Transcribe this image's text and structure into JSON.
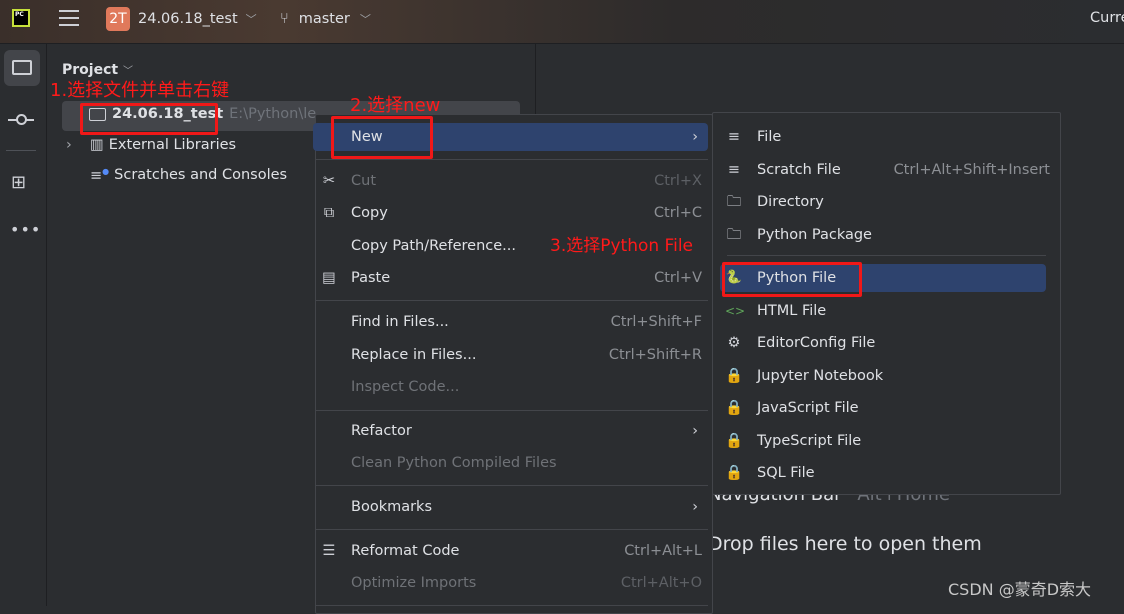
{
  "titlebar": {
    "project_badge": "2T",
    "project_name": "24.06.18_test",
    "branch": "master",
    "right_text": "Curre",
    "badge_color": "#e0795b"
  },
  "project_panel": {
    "title": "Project",
    "tree": [
      {
        "label": "24.06.18_test",
        "path": "E:\\Python\\le",
        "icon": "folder-icon"
      },
      {
        "label": "External Libraries",
        "icon": "library-icon"
      },
      {
        "label": "Scratches and Consoles",
        "icon": "scratch-icon"
      }
    ]
  },
  "context_menu": {
    "items": [
      {
        "label": "New",
        "submenu": true,
        "highlighted": true
      },
      {
        "separator": true
      },
      {
        "label": "Cut",
        "shortcut": "Ctrl+X",
        "icon": "scissors-icon",
        "disabled": true
      },
      {
        "label": "Copy",
        "shortcut": "Ctrl+C",
        "icon": "copy-icon"
      },
      {
        "label": "Copy Path/Reference..."
      },
      {
        "label": "Paste",
        "shortcut": "Ctrl+V",
        "icon": "paste-icon"
      },
      {
        "separator": true
      },
      {
        "label": "Find in Files...",
        "shortcut": "Ctrl+Shift+F"
      },
      {
        "label": "Replace in Files...",
        "shortcut": "Ctrl+Shift+R"
      },
      {
        "label": "Inspect Code...",
        "disabled": true
      },
      {
        "separator": true
      },
      {
        "label": "Refactor",
        "submenu": true
      },
      {
        "label": "Clean Python Compiled Files",
        "disabled": true
      },
      {
        "separator": true
      },
      {
        "label": "Bookmarks",
        "submenu": true
      },
      {
        "separator": true
      },
      {
        "label": "Reformat Code",
        "shortcut": "Ctrl+Alt+L",
        "icon": "reformat-icon"
      },
      {
        "label": "Optimize Imports",
        "shortcut": "Ctrl+Alt+O",
        "disabled": true
      },
      {
        "separator": true
      }
    ]
  },
  "new_submenu": {
    "items": [
      {
        "label": "File",
        "icon": "file-icon"
      },
      {
        "label": "Scratch File",
        "shortcut": "Ctrl+Alt+Shift+Insert",
        "icon": "scratch-file-icon"
      },
      {
        "label": "Directory",
        "icon": "folder-icon"
      },
      {
        "label": "Python Package",
        "icon": "package-icon"
      },
      {
        "separator": true
      },
      {
        "label": "Python File",
        "icon": "python-icon",
        "highlighted": true
      },
      {
        "label": "HTML File",
        "icon": "html-icon"
      },
      {
        "label": "EditorConfig File",
        "icon": "gear-icon"
      },
      {
        "label": "Jupyter Notebook",
        "icon": "lock-icon"
      },
      {
        "label": "JavaScript File",
        "icon": "lock-icon"
      },
      {
        "label": "TypeScript File",
        "icon": "lock-icon"
      },
      {
        "label": "SQL File",
        "icon": "lock-icon"
      }
    ]
  },
  "editor": {
    "nav_bar": "Navigation Bar",
    "nav_bar_shortcut": "Alt+Home",
    "drop_hint": "Drop files here to open them"
  },
  "annotations": {
    "step1": "1.选择文件并单击右键",
    "step2": "2.选择new",
    "step3": "3.选择Python File",
    "color": "#ff1a1a"
  },
  "watermark": "CSDN @蒙奇D索大"
}
